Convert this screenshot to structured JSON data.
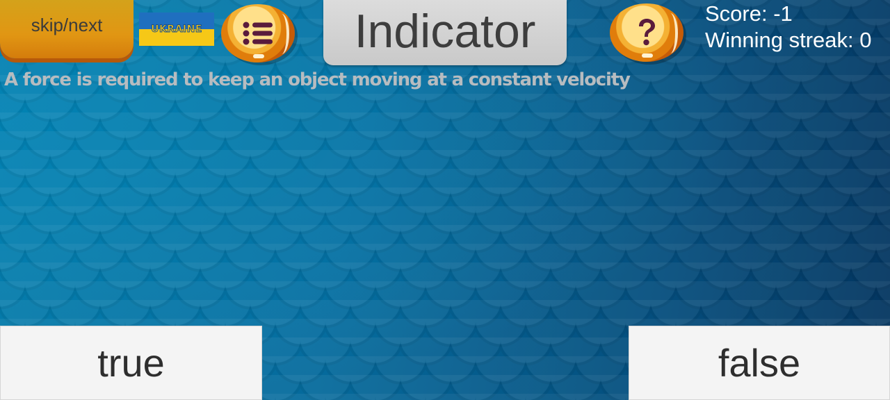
{
  "toolbar": {
    "skip_label": "skip/next",
    "flag_label": "UKRAINE",
    "menu_icon": "list-icon",
    "help_icon": "question-icon"
  },
  "title": "Indicator",
  "stats": {
    "score": "Score: -1",
    "streak": "Winning streak: 0"
  },
  "question": "A force is required to keep an object moving at a constant velocity",
  "answers": {
    "true_label": "true",
    "false_label": "false"
  },
  "colors": {
    "button_orange": "#e19613",
    "icon_purple": "#5a1b3c",
    "background_blue": "#04598a",
    "panel_gray": "#d6d6d6"
  }
}
